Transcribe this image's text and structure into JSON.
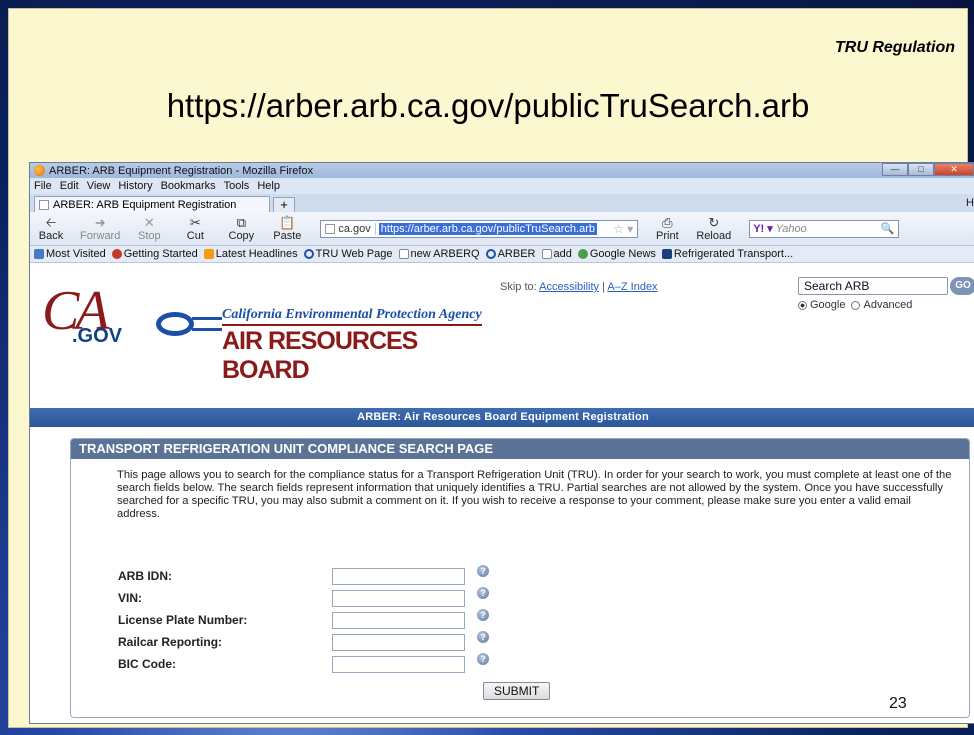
{
  "slide": {
    "tag": "TRU Regulation",
    "heading_url": "https://arber.arb.ca.gov/publicTruSearch.arb",
    "page_number": "23"
  },
  "browser": {
    "window_title": "ARBER: ARB Equipment Registration - Mozilla Firefox",
    "menu": [
      "File",
      "Edit",
      "View",
      "History",
      "Bookmarks",
      "Tools",
      "Help"
    ],
    "tab_title": "ARBER: ARB Equipment Registration",
    "new_tab": "+",
    "nav": {
      "back": "Back",
      "forward": "Forward",
      "stop": "Stop",
      "cut": "Cut",
      "copy": "Copy",
      "paste": "Paste",
      "print": "Print",
      "reload": "Reload"
    },
    "site_identity": "ca.gov",
    "address": "https://arber.arb.ca.gov/publicTruSearch.arb",
    "search_engine_label": "Y! ▾",
    "search_placeholder": "Yahoo",
    "edge_char": "H",
    "bookmarks": [
      {
        "label": "Most Visited",
        "icon": "bookmark-folder-icon",
        "color": "#4a78c8"
      },
      {
        "label": "Getting Started",
        "icon": "firefox-icon",
        "color": "#c0392b"
      },
      {
        "label": "Latest Headlines",
        "icon": "rss-icon",
        "color": "#f39c12"
      },
      {
        "label": "TRU Web Page",
        "icon": "arb-icon",
        "color": "#1b4fa8"
      },
      {
        "label": "new ARBERQ",
        "icon": "page-icon",
        "color": "#ffffff"
      },
      {
        "label": "ARBER",
        "icon": "arb-icon",
        "color": "#1b4fa8"
      },
      {
        "label": "add",
        "icon": "page-icon",
        "color": "#ffffff"
      },
      {
        "label": "Google News",
        "icon": "google-news-icon",
        "color": "#4aa04a"
      },
      {
        "label": "Refrigerated Transport...",
        "icon": "rt-icon",
        "color": "#1b3f7a"
      }
    ]
  },
  "site": {
    "logo_ca": "CA",
    "logo_gov": ".GOV",
    "agency": "California Environmental Protection Agency",
    "board": "AIR RESOURCES BOARD",
    "skip_to": "Skip to:",
    "accessibility": "Accessibility",
    "separator": "|",
    "az_index": "A–Z Index",
    "search_value": "Search ARB",
    "go": "GO",
    "radio_google": "Google",
    "radio_advanced": "Advanced",
    "arber_bar": "ARBER: Air Resources Board Equipment Registration"
  },
  "form": {
    "title": "TRANSPORT REFRIGERATION UNIT COMPLIANCE SEARCH PAGE",
    "intro": "This page allows you to search for the compliance status for a Transport Refrigeration Unit (TRU). In order for your search to work, you must complete at least one of the search fields below. The search fields represent information that uniquely identifies a TRU. Partial searches are not allowed by the system. Once you have successfully searched for a specific TRU, you may also submit a comment on it. If you wish to receive a response to your comment, please make sure you enter a valid email address.",
    "fields": [
      {
        "label": "ARB IDN:",
        "value": ""
      },
      {
        "label": "VIN:",
        "value": ""
      },
      {
        "label": "License Plate Number:",
        "value": ""
      },
      {
        "label": "Railcar Reporting:",
        "value": ""
      },
      {
        "label": "BIC Code:",
        "value": ""
      }
    ],
    "help_glyph": "?",
    "submit": "SUBMIT"
  }
}
